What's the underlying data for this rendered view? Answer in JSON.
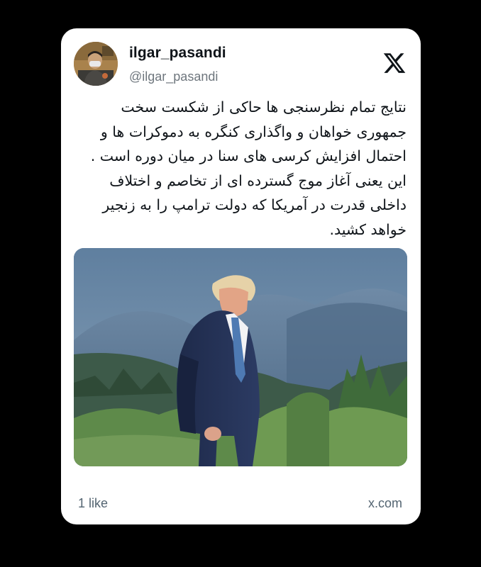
{
  "tweet": {
    "display_name": "ilgar_pasandi",
    "handle": "@ilgar_pasandi",
    "text": "نتایج تمام نظرسنجی ها حاکی از شکست سخت\nجمهوری خواهان و واگذاری کنگره به دموکرات ها و\nاحتمال افزایش کرسی های سنا در میان دوره است .\nاین یعنی آغاز موج گسترده ای از تخاصم و اختلاف\nداخلی قدرت در آمریکا که دولت ترامپ را به زنجیر\nخواهد کشید.",
    "likes_label": "1 like",
    "source_label": "x.com"
  },
  "icons": {
    "brand": "x-logo-icon"
  },
  "colors": {
    "background": "#000000",
    "card": "#ffffff",
    "text_primary": "#0f1419",
    "text_secondary": "#536471"
  }
}
